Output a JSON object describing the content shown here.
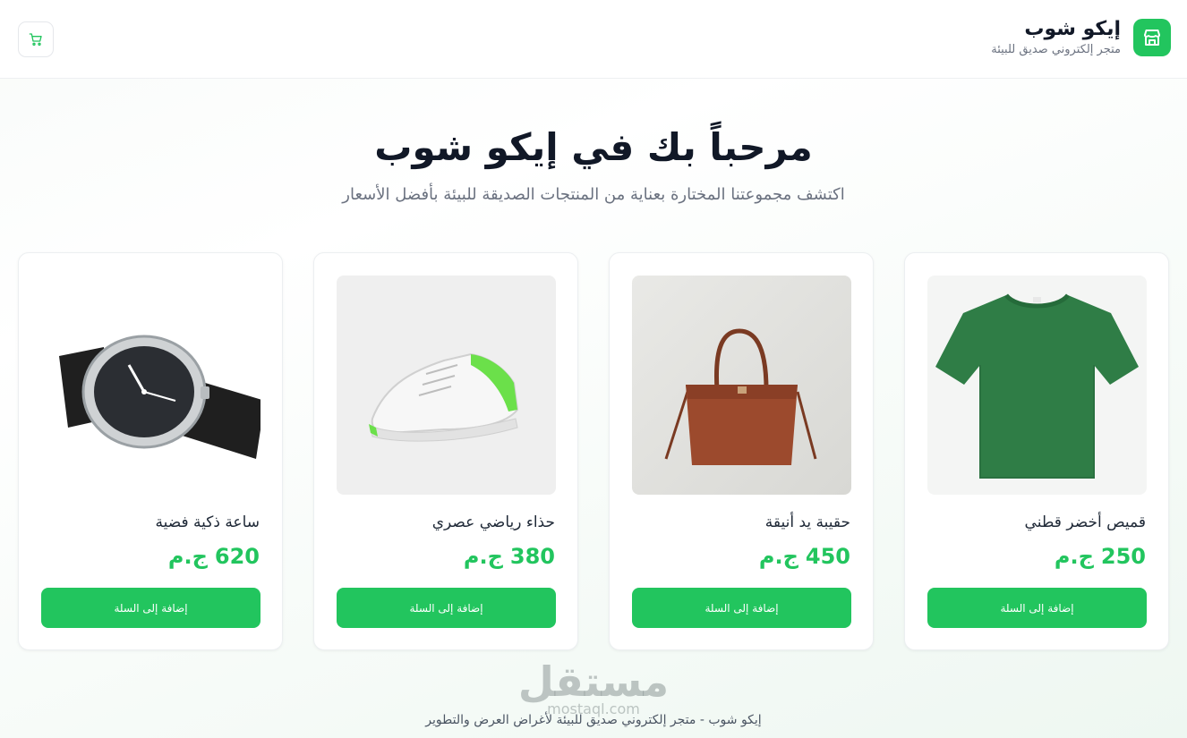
{
  "header": {
    "brand_name": "إيكو شوب",
    "brand_tagline": "متجر إلكتروني صديق للبيئة"
  },
  "hero": {
    "title": "مرحباً بك في إيكو شوب",
    "subtitle": "اكتشف مجموعتنا المختارة بعناية من المنتجات الصديقة للبيئة بأفضل الأسعار"
  },
  "products": [
    {
      "name": "قميص أخضر قطني",
      "price": "250",
      "currency": "ج.م",
      "button": "إضافة إلى السلة",
      "image": "green-tshirt"
    },
    {
      "name": "حقيبة يد أنيقة",
      "price": "450",
      "currency": "ج.م",
      "button": "إضافة إلى السلة",
      "image": "brown-handbag"
    },
    {
      "name": "حذاء رياضي عصري",
      "price": "380",
      "currency": "ج.م",
      "button": "إضافة إلى السلة",
      "image": "white-sneaker"
    },
    {
      "name": "ساعة ذكية فضية",
      "price": "620",
      "currency": "ج.م",
      "button": "إضافة إلى السلة",
      "image": "silver-watch"
    }
  ],
  "watermark": {
    "logo": "مستقل",
    "site": "mostaql.com"
  },
  "footer": {
    "text": "إيكو شوب - متجر إلكتروني صديق للبيئة لأغراض العرض والتطوير"
  },
  "colors": {
    "accent": "#22c55e",
    "text": "#1f2937",
    "muted": "#6b7280"
  },
  "icons": [
    "store-icon",
    "cart-icon"
  ]
}
